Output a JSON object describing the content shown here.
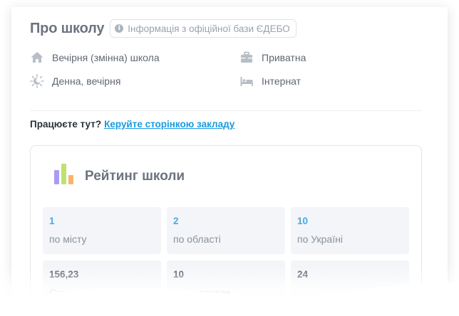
{
  "about": {
    "title": "Про школу",
    "source_badge": "Інформація з офіційної бази ЄДЕБО"
  },
  "facts": {
    "school_type": "Вечірня (змінна) школа",
    "ownership": "Приватна",
    "study_form": "Денна, вечірня",
    "boarding": "Інтернат"
  },
  "work": {
    "question": "Працюєте тут?",
    "link": "Керуйте сторінкою закладу"
  },
  "rating": {
    "title": "Рейтинг школи",
    "tiles": [
      {
        "value": "1",
        "label": "по місту"
      },
      {
        "value": "2",
        "label": "по області"
      },
      {
        "value": "10",
        "label": "по Україні"
      },
      {
        "value": "156,23",
        "label": "Середній бал"
      },
      {
        "value": "10",
        "label": "учнів здавав"
      },
      {
        "value": "24",
        "label": ""
      }
    ]
  },
  "colors": {
    "link": "#1a9be0",
    "rank_value": "#4aa8e8",
    "icon_gray": "#b8bec6",
    "bar_purple": "#a99cf0",
    "bar_green": "#bde26e",
    "bar_orange": "#f8b46a"
  },
  "icons": [
    "home-icon",
    "briefcase-icon",
    "sun-moon-icon",
    "bed-icon",
    "info-icon",
    "bar-chart-icon"
  ]
}
